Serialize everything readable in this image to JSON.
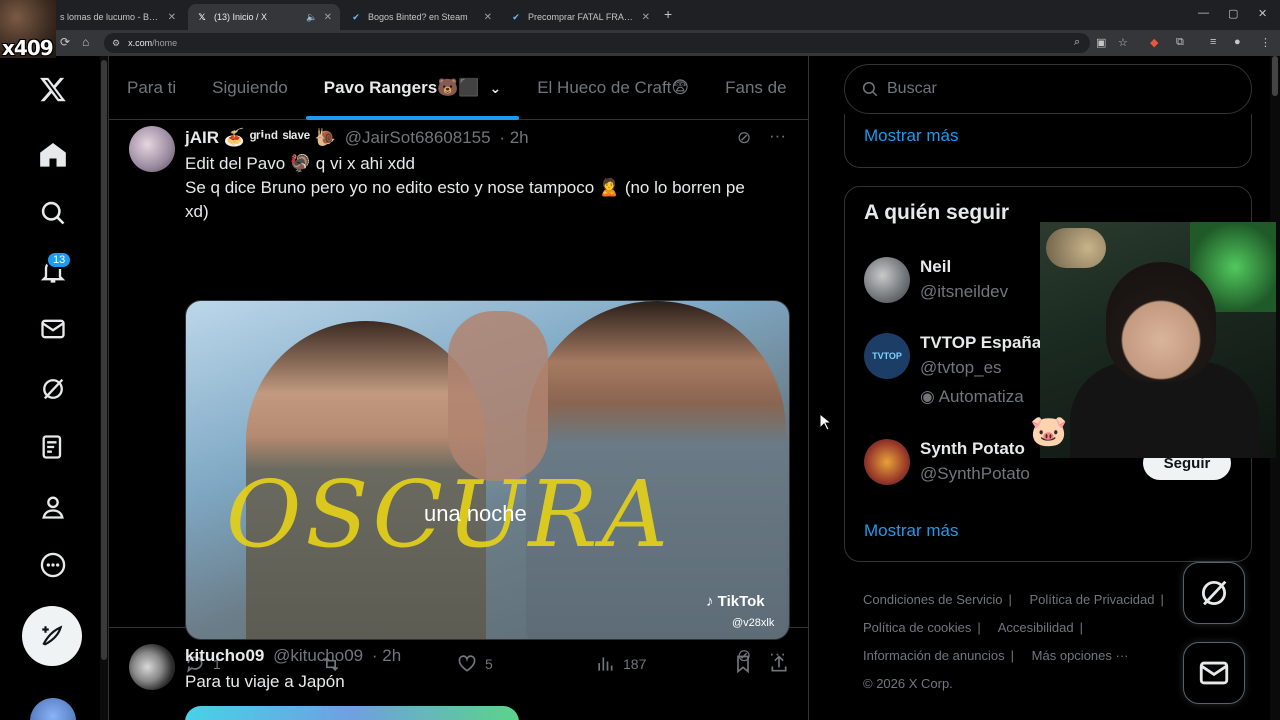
{
  "browser": {
    "tabs": [
      {
        "title": "s lomas de lucumo - Buscar c",
        "close": "✕"
      },
      {
        "title": "(13) Inicio / X",
        "close": "✕",
        "audio": "🔈"
      },
      {
        "title": "Bogos Binted? en Steam",
        "close": "✕"
      },
      {
        "title": "Precomprar FATAL FRAME II: Cr",
        "close": "✕"
      }
    ],
    "new_tab": "+",
    "window_controls": [
      "—",
      "▢",
      "✕"
    ],
    "url": "x.com/home",
    "url_prefix": "x.com",
    "url_path": "/home"
  },
  "overlay": {
    "stream_label": "x409"
  },
  "nav": {
    "notification_count": "13"
  },
  "feed_tabs": [
    {
      "label": "Para ti"
    },
    {
      "label": "Siguiendo"
    },
    {
      "label": "Pavo Rangers🐻‍⬛",
      "chevron": "⌄"
    },
    {
      "label": "El Hueco de Craft😨"
    },
    {
      "label": "Fans de"
    }
  ],
  "tweets": [
    {
      "name": "jAIR 🍝 ᵍʳⁱⁿᵈ ˢˡᵃᵛᵉ 🐌",
      "handle": "@JairSot68608155",
      "time": "· 2h",
      "text_lines": [
        "Edit del Pavo 🦃 q vi x ahi xdd",
        "Se q dice Bruno pero yo no edito esto y nose tampoco 🙎 (no lo borren pe",
        "xd)"
      ],
      "media": {
        "overlay_big": "OSCURA",
        "overlay_small": "una noche",
        "watermark": "TikTok",
        "watermark_handle": "@v28xlk"
      },
      "replies": "1",
      "reposts": "",
      "likes": "5",
      "views": "187"
    },
    {
      "name": "kitucho09",
      "handle": "@kitucho09",
      "time": "· 2h",
      "text_lines": [
        "Para tu viaje a Japón"
      ]
    }
  ],
  "right": {
    "search_placeholder": "Buscar",
    "show_more_1": "Mostrar más",
    "who_to_follow_title": "A quién seguir",
    "suggestions": [
      {
        "name": "Neil",
        "handle": "@itsneildev"
      },
      {
        "name": "TVTOP España",
        "handle": "@tvtop_es",
        "extra": "Automatiza",
        "avatar_text": "TVTOP"
      },
      {
        "name": "Synth Potato",
        "handle": "@SynthPotato",
        "button": "Seguir"
      }
    ],
    "show_more_2": "Mostrar más",
    "footer": {
      "links": [
        "Condiciones de Servicio",
        "Política de Privacidad",
        "Política de cookies",
        "Accesibilidad",
        "Información de anuncios",
        "Más opciones ···"
      ],
      "sep": "|",
      "copyright": "© 2026 X Corp."
    }
  },
  "colors": {
    "accent": "#1d9bf0",
    "background": "#000000",
    "border": "#2f3336",
    "muted_text": "#71767b",
    "primary_text": "#e7e9ea"
  }
}
